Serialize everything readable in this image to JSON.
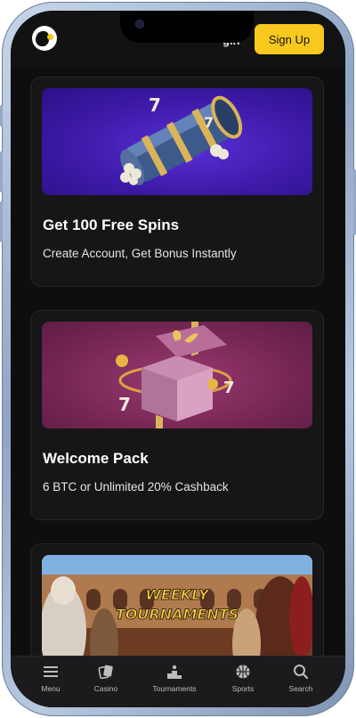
{
  "header": {
    "logo_icon": "bear-logo-icon",
    "login_fragment": "gin",
    "signup_label": "Sign Up"
  },
  "cards": [
    {
      "title": "Get 100 Free Spins",
      "subtitle": "Create Account, Get Bonus Instantly",
      "image": "slot-reel-icon"
    },
    {
      "title": "Welcome Pack",
      "subtitle": "6 BTC or Unlimited 20% Cashback",
      "image": "gift-box-icon"
    },
    {
      "image_text_line1": "WEEKLY",
      "image_text_line2": "TOURNAMENTS",
      "image": "arena-icon"
    }
  ],
  "nav": {
    "items": [
      {
        "label": "Menu",
        "icon": "menu-icon"
      },
      {
        "label": "Casino",
        "icon": "cards-icon"
      },
      {
        "label": "Tournaments",
        "icon": "podium-icon"
      },
      {
        "label": "Sports",
        "icon": "basketball-icon"
      },
      {
        "label": "Search",
        "icon": "search-icon"
      }
    ]
  },
  "colors": {
    "accent": "#f8c81e",
    "background": "#0e0e0f",
    "card": "#161617"
  }
}
